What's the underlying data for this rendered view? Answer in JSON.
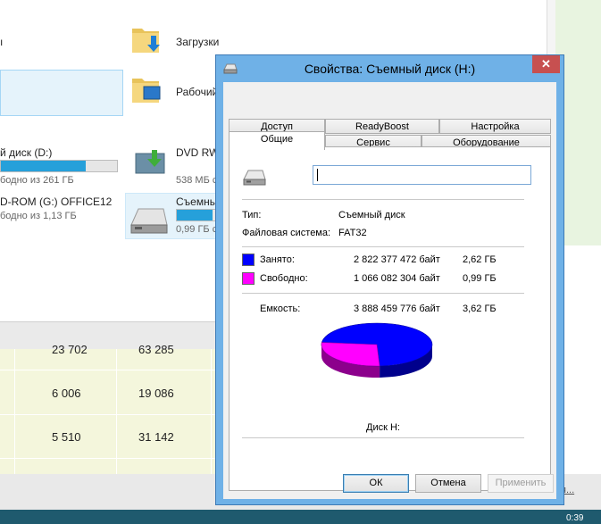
{
  "background": {
    "folders": [
      {
        "label": "Загрузки"
      },
      {
        "label": "Рабочий"
      }
    ],
    "drives": [
      {
        "name": "й диск (D:)",
        "free": "бодно из 261 ГБ",
        "fill": 0.73
      },
      {
        "name": "DVD RW",
        "free": "538 МБ с"
      },
      {
        "name": "D-ROM (G:) OFFICE12",
        "free": "бодно из 1,13 ГБ"
      },
      {
        "name": "Съемны",
        "free": "0,99 ГБ с",
        "fill": 0.9
      }
    ],
    "grid_rows": [
      [
        "23 702",
        "63 285"
      ],
      [
        "6 006",
        "19 086"
      ],
      [
        "5 510",
        "31 142"
      ]
    ],
    "link_text": "я...",
    "clock": "0:39"
  },
  "dialog": {
    "title": "Свойства: Съемный диск (H:)",
    "close_label": "✕",
    "tabs_back": [
      "Доступ",
      "ReadyBoost",
      "Настройка"
    ],
    "tabs_front": [
      "Общие",
      "Сервис",
      "Оборудование"
    ],
    "name_value": "",
    "type_label": "Тип:",
    "type_value": "Съемный диск",
    "fs_label": "Файловая система:",
    "fs_value": "FAT32",
    "used_label": "Занято:",
    "used_bytes": "2 822 377 472 байт",
    "used_gb": "2,62 ГБ",
    "used_color": "#0000ff",
    "free_label": "Свободно:",
    "free_bytes": "1 066 082 304 байт",
    "free_gb": "0,99 ГБ",
    "free_color": "#ff00ff",
    "capacity_label": "Емкость:",
    "capacity_bytes": "3 888 459 776 байт",
    "capacity_gb": "3,62 ГБ",
    "disk_label": "Диск H:",
    "used_fraction": 0.7258,
    "buttons": {
      "ok": "ОК",
      "cancel": "Отмена",
      "apply": "Применить"
    }
  }
}
